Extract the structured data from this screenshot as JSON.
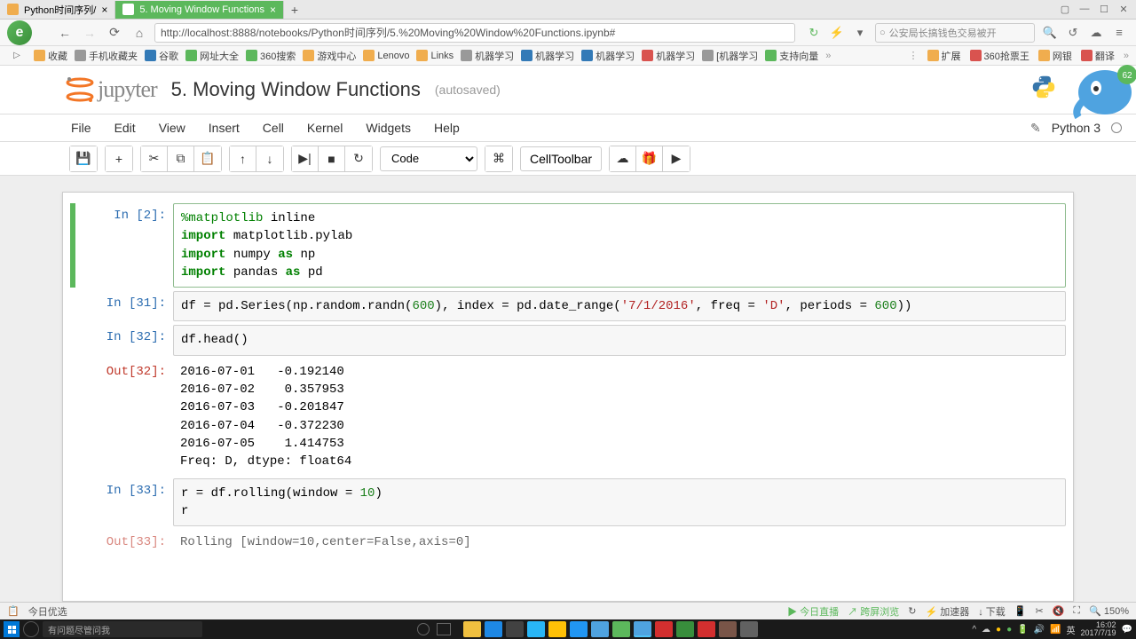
{
  "browser": {
    "tabs": [
      {
        "title": "Python时间序列/",
        "active": false
      },
      {
        "title": "5. Moving Window Functions",
        "active": true
      }
    ],
    "url": "http://localhost:8888/notebooks/Python时间序列/5.%20Moving%20Window%20Functions.ipynb#",
    "search_placeholder": "公安局长搞钱色交易被开",
    "bookmarks": [
      "收藏",
      "手机收藏夹",
      "谷歌",
      "网址大全",
      "360搜索",
      "游戏中心",
      "Lenovo",
      "Links",
      "机器学习",
      "机器学习",
      "机器学习",
      "机器学习",
      "[机器学习",
      "支持向量"
    ],
    "bm_right": [
      "扩展",
      "360抢票王",
      "网银",
      "翻译"
    ]
  },
  "jupyter": {
    "logo_text": "jupyter",
    "title": "5. Moving Window Functions",
    "autosaved": "(autosaved)",
    "menu": [
      "File",
      "Edit",
      "View",
      "Insert",
      "Cell",
      "Kernel",
      "Widgets",
      "Help"
    ],
    "kernel_name": "Python 3",
    "cell_type": "Code",
    "celltoolbar_label": "CellToolbar"
  },
  "cells": {
    "c1_prompt": "In [2]:",
    "c1_line1_magic": "%matplotlib",
    "c1_line1_rest": " inline",
    "c1_import": "import",
    "c1_as": "as",
    "c1_m1": " matplotlib.pylab",
    "c1_m2": " numpy ",
    "c1_m2a": " np",
    "c1_m3": " pandas ",
    "c1_m3a": " pd",
    "c2_prompt": "In [31]:",
    "c2_code_a": "df = pd.Series(np.random.randn(",
    "c2_num1": "600",
    "c2_code_b": "), index = pd.date_range(",
    "c2_str1": "'7/1/2016'",
    "c2_code_c": ", freq = ",
    "c2_str2": "'D'",
    "c2_code_d": ", periods = ",
    "c2_num2": "600",
    "c2_code_e": "))",
    "c3_prompt": "In [32]:",
    "c3_code": "df.head()",
    "c3_out_prompt": "Out[32]:",
    "c3_output": "2016-07-01   -0.192140\n2016-07-02    0.357953\n2016-07-03   -0.201847\n2016-07-04   -0.372230\n2016-07-05    1.414753\nFreq: D, dtype: float64",
    "c4_prompt": "In [33]:",
    "c4_code_a": "r = df.rolling(window = ",
    "c4_num": "10",
    "c4_code_b": ")\nr",
    "c4_out_prompt": "Out[33]:",
    "c4_output": "Rolling [window=10,center=False,axis=0]"
  },
  "status": {
    "left": "今日优选",
    "right": [
      "今日直播",
      "跨屏浏览",
      "加速器",
      "下载",
      "150%"
    ]
  },
  "taskbar": {
    "search": "有问题尽管问我",
    "time": "16:02",
    "date": "2017/7/19",
    "ime": "英"
  }
}
